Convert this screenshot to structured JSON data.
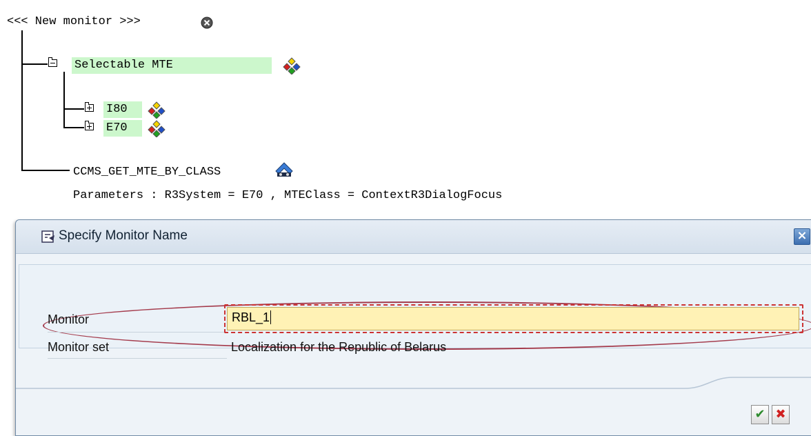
{
  "tree": {
    "root_label": "<<< New monitor >>>",
    "node_selectable": "Selectable MTE",
    "child_1": "I80",
    "child_2": "E70",
    "method_label": "CCMS_GET_MTE_BY_CLASS",
    "parameters": "Parameters : R3System = E70 , MTEClass = ContextR3DialogFocus"
  },
  "dialog": {
    "title": "Specify Monitor Name",
    "close_icon": "close-icon",
    "fields": {
      "monitor_label": "Monitor",
      "monitor_value": "RBL_1",
      "monitor_set_label": "Monitor set",
      "monitor_set_value": "Localization for the Republic of Belarus"
    },
    "buttons": {
      "confirm_icon": "checkmark-icon",
      "cancel_icon": "cancel-x-icon"
    },
    "colors": {
      "input_bg": "#fff2b5",
      "highlight": "#a43b4c",
      "node_green": "#ccf7cc"
    }
  }
}
